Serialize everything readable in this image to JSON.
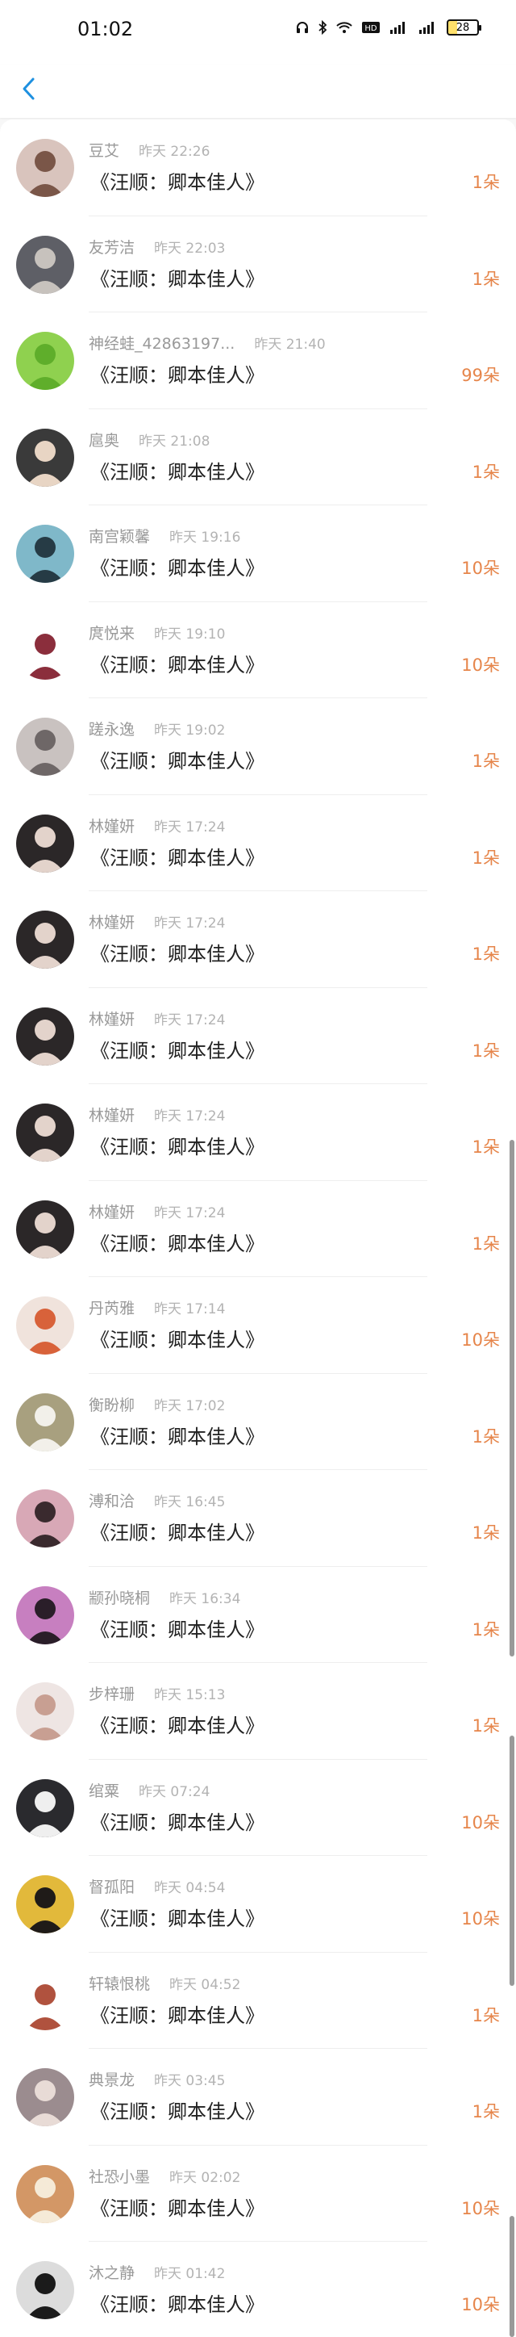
{
  "status_bar": {
    "time": "01:02",
    "battery": "28",
    "icons": [
      "headphones-icon",
      "bluetooth-icon",
      "wifi-icon",
      "hd-icon",
      "signal-icon",
      "signal-icon"
    ]
  },
  "nav": {
    "back_icon": "chevron-left-icon"
  },
  "colors": {
    "accent": "#1e90e0",
    "count": "#e6854a"
  },
  "gifts": [
    {
      "user": "豆艾",
      "time": "昨天 22:26",
      "gift": "《汪顺：卿本佳人》",
      "count": "1朵",
      "avatar": {
        "bg": "#d9c4bd",
        "fg": "#7a5648"
      }
    },
    {
      "user": "友芳洁",
      "time": "昨天 22:03",
      "gift": "《汪顺：卿本佳人》",
      "count": "1朵",
      "avatar": {
        "bg": "#5e5f66",
        "fg": "#c7c2bd"
      }
    },
    {
      "user": "神经蛙_42863197...",
      "time": "昨天 21:40",
      "gift": "《汪顺：卿本佳人》",
      "count": "99朵",
      "avatar": {
        "bg": "#8fd14f",
        "fg": "#5fae2b"
      }
    },
    {
      "user": "扈奥",
      "time": "昨天 21:08",
      "gift": "《汪顺：卿本佳人》",
      "count": "1朵",
      "avatar": {
        "bg": "#3a3a3a",
        "fg": "#e8d5c4"
      }
    },
    {
      "user": "南宫颖馨",
      "time": "昨天 19:16",
      "gift": "《汪顺：卿本佳人》",
      "count": "10朵",
      "avatar": {
        "bg": "#7fb8c9",
        "fg": "#263b45"
      }
    },
    {
      "user": "庹悦来",
      "time": "昨天 19:10",
      "gift": "《汪顺：卿本佳人》",
      "count": "10朵",
      "avatar": {
        "bg": "#ffffff",
        "fg": "#8b2e3c"
      }
    },
    {
      "user": "蹉永逸",
      "time": "昨天 19:02",
      "gift": "《汪顺：卿本佳人》",
      "count": "1朵",
      "avatar": {
        "bg": "#c9c2c0",
        "fg": "#6e6767"
      }
    },
    {
      "user": "林嫤妍",
      "time": "昨天 17:24",
      "gift": "《汪顺：卿本佳人》",
      "count": "1朵",
      "avatar": {
        "bg": "#2b2728",
        "fg": "#e3d3cb"
      }
    },
    {
      "user": "林嫤妍",
      "time": "昨天 17:24",
      "gift": "《汪顺：卿本佳人》",
      "count": "1朵",
      "avatar": {
        "bg": "#2b2728",
        "fg": "#e3d3cb"
      }
    },
    {
      "user": "林嫤妍",
      "time": "昨天 17:24",
      "gift": "《汪顺：卿本佳人》",
      "count": "1朵",
      "avatar": {
        "bg": "#2b2728",
        "fg": "#e3d3cb"
      }
    },
    {
      "user": "林嫤妍",
      "time": "昨天 17:24",
      "gift": "《汪顺：卿本佳人》",
      "count": "1朵",
      "avatar": {
        "bg": "#2b2728",
        "fg": "#e3d3cb"
      }
    },
    {
      "user": "林嫤妍",
      "time": "昨天 17:24",
      "gift": "《汪顺：卿本佳人》",
      "count": "1朵",
      "avatar": {
        "bg": "#2b2728",
        "fg": "#e3d3cb"
      }
    },
    {
      "user": "丹芮雅",
      "time": "昨天 17:14",
      "gift": "《汪顺：卿本佳人》",
      "count": "10朵",
      "avatar": {
        "bg": "#f0e3dc",
        "fg": "#d8623a"
      }
    },
    {
      "user": "衡盼柳",
      "time": "昨天 17:02",
      "gift": "《汪顺：卿本佳人》",
      "count": "1朵",
      "avatar": {
        "bg": "#a8a07f",
        "fg": "#f2f0ea"
      }
    },
    {
      "user": "溥和洽",
      "time": "昨天 16:45",
      "gift": "《汪顺：卿本佳人》",
      "count": "1朵",
      "avatar": {
        "bg": "#d8a8b6",
        "fg": "#3a2a2e"
      }
    },
    {
      "user": "颛孙晓桐",
      "time": "昨天 16:34",
      "gift": "《汪顺：卿本佳人》",
      "count": "1朵",
      "avatar": {
        "bg": "#c77fc0",
        "fg": "#2a1e29"
      }
    },
    {
      "user": "步梓珊",
      "time": "昨天 15:13",
      "gift": "《汪顺：卿本佳人》",
      "count": "1朵",
      "avatar": {
        "bg": "#eee5e3",
        "fg": "#c89f92"
      }
    },
    {
      "user": "绾粟",
      "time": "昨天 07:24",
      "gift": "《汪顺：卿本佳人》",
      "count": "10朵",
      "avatar": {
        "bg": "#2a2a2e",
        "fg": "#efefef"
      }
    },
    {
      "user": "督孤阳",
      "time": "昨天 04:54",
      "gift": "《汪顺：卿本佳人》",
      "count": "10朵",
      "avatar": {
        "bg": "#e2b93b",
        "fg": "#1f1b18"
      }
    },
    {
      "user": "轩辕恨桃",
      "time": "昨天 04:52",
      "gift": "《汪顺：卿本佳人》",
      "count": "1朵",
      "avatar": {
        "bg": "#ffffff",
        "fg": "#b0523e"
      }
    },
    {
      "user": "典景龙",
      "time": "昨天 03:45",
      "gift": "《汪顺：卿本佳人》",
      "count": "1朵",
      "avatar": {
        "bg": "#9b8c8f",
        "fg": "#e8dbd6"
      }
    },
    {
      "user": "社恐小墨",
      "time": "昨天 02:02",
      "gift": "《汪顺：卿本佳人》",
      "count": "10朵",
      "avatar": {
        "bg": "#d39766",
        "fg": "#f5ead7"
      }
    },
    {
      "user": "沐之静",
      "time": "昨天 01:42",
      "gift": "《汪顺：卿本佳人》",
      "count": "10朵",
      "avatar": {
        "bg": "#dcdcdc",
        "fg": "#1b1b1b"
      }
    }
  ]
}
